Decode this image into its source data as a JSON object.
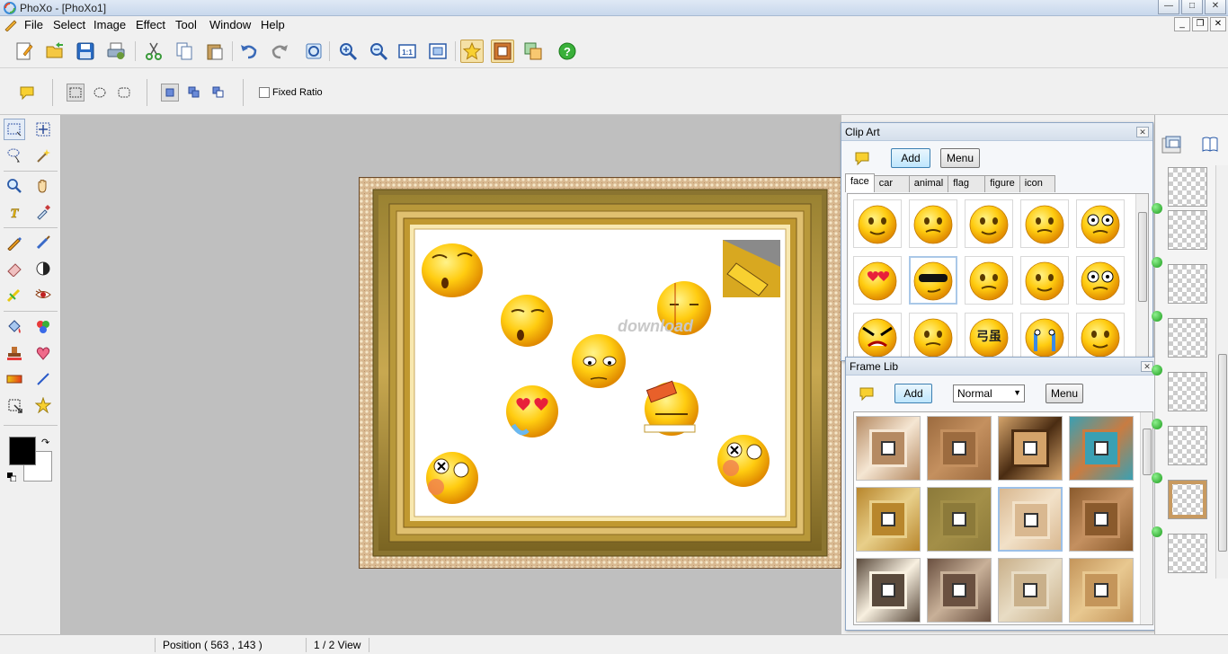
{
  "window": {
    "title": "PhoXo - [PhoXo1]",
    "controls": {
      "minimize": "—",
      "maximize": "□",
      "close": "✕"
    }
  },
  "menu": {
    "items": [
      "File",
      "Select",
      "Image",
      "Effect",
      "Tool",
      "Window",
      "Help"
    ]
  },
  "mdi_controls": {
    "minimize": "_",
    "restore": "❐",
    "close": "✕"
  },
  "toolbar": {
    "icons": [
      "new-icon",
      "open-icon",
      "save-icon",
      "print-icon",
      "cut-icon",
      "copy-icon",
      "paste-icon",
      "undo-icon",
      "redo-icon",
      "refresh-icon",
      "zoom-in-icon",
      "zoom-out-icon",
      "actual-size-icon",
      "fit-window-icon",
      "clipart-icon",
      "frame-icon",
      "layers-icon",
      "help-icon"
    ]
  },
  "options": {
    "fixed_ratio_label": "Fixed Ratio",
    "fixed_ratio_checked": false
  },
  "status": {
    "position": "Position ( 563 , 143 )",
    "view": "1 / 2 View"
  },
  "canvas": {
    "watermark": "download"
  },
  "clip_art": {
    "title": "Clip Art",
    "add_label": "Add",
    "menu_label": "Menu",
    "tabs": [
      "face",
      "car",
      "animal",
      "flag",
      "figure",
      "icon"
    ],
    "active_tab": "face",
    "items": [
      "surprised-face",
      "open-mouth-face",
      "sweat-face",
      "brick-head-face",
      "dizzy-face",
      "in-love-face",
      "cool-sunglasses-face",
      "cut-face",
      "laughing-face",
      "angry-face",
      "evil-face",
      "cold-face",
      "text-face",
      "crying-face",
      "sad-face"
    ],
    "selected_index": 6
  },
  "frame_lib": {
    "title": "Frame Lib",
    "add_label": "Add",
    "mode_value": "Normal",
    "menu_label": "Menu",
    "selected_index": 6,
    "frames": [
      {
        "outer": "#b58a62",
        "inner": "#f5e6d3"
      },
      {
        "outer": "#9c6b3f",
        "inner": "#c4905f"
      },
      {
        "outer": "#d4a36a",
        "inner": "#4a2c12"
      },
      {
        "outer": "#3aa0b3",
        "inner": "#c87c42"
      },
      {
        "outer": "#b8862c",
        "inner": "#e8cf8a"
      },
      {
        "outer": "#8c7a3a",
        "inner": "#a38f48"
      },
      {
        "outer": "#d9b890",
        "inner": "#f2e1c8"
      },
      {
        "outer": "#8a5a2c",
        "inner": "#c49060"
      },
      {
        "outer": "#5a4a3c",
        "inner": "#f8f0e0"
      },
      {
        "outer": "#6a5040",
        "inner": "#c8b098"
      },
      {
        "outer": "#c9b08a",
        "inner": "#e8dcc4"
      },
      {
        "outer": "#c4955a",
        "inner": "#e8c890"
      }
    ]
  },
  "colors": {
    "foreground": "#000000",
    "background": "#ffffff",
    "canvas_bg": "#bfbfbf",
    "accent": "#3c7fb1"
  }
}
